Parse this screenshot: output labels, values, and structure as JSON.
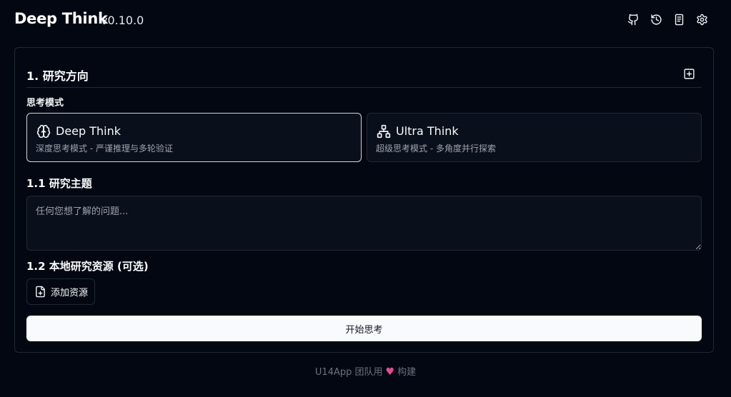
{
  "app": {
    "title": "Deep Think",
    "version": "v0.10.0"
  },
  "header_icons": [
    "github-icon",
    "history-icon",
    "notebook-icon",
    "settings-icon"
  ],
  "section": {
    "title": "1. 研究方向",
    "add_icon": "square-plus-icon"
  },
  "mode": {
    "label": "思考模式",
    "selected": "deep",
    "options": [
      {
        "id": "deep",
        "name": "Deep Think",
        "description": "深度思考模式 - 严谨推理与多轮验证",
        "icon": "brain-icon"
      },
      {
        "id": "ultra",
        "name": "Ultra Think",
        "description": "超级思考模式 - 多角度并行探索",
        "icon": "network-icon"
      }
    ]
  },
  "topic": {
    "label": "1.1 研究主题",
    "placeholder": "任何您想了解的问题...",
    "value": ""
  },
  "resources": {
    "label": "1.2 本地研究资源 (可选)",
    "add_button": "添加资源",
    "add_icon": "file-plus-icon"
  },
  "start_button": "开始思考",
  "footer": {
    "prefix": "U14App 团队用",
    "suffix": "构建",
    "icon": "heart-icon"
  },
  "colors": {
    "background": "#030712",
    "border": "#1f2937",
    "primary_button": "#f9fafb",
    "heart": "#ec4899"
  }
}
